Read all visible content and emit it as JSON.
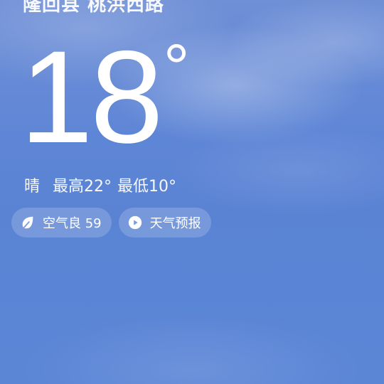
{
  "header": {
    "location": "隆回县 桃洪西路"
  },
  "weather": {
    "temperature": "18",
    "unit": "°",
    "condition": "晴",
    "high_label": "最高",
    "high_value": "22°",
    "low_label": "最低",
    "low_value": "10°"
  },
  "pills": {
    "air_quality": {
      "icon": "leaf-icon",
      "label": "空气良 59"
    },
    "forecast": {
      "icon": "play-icon",
      "label": "天气预报"
    }
  }
}
